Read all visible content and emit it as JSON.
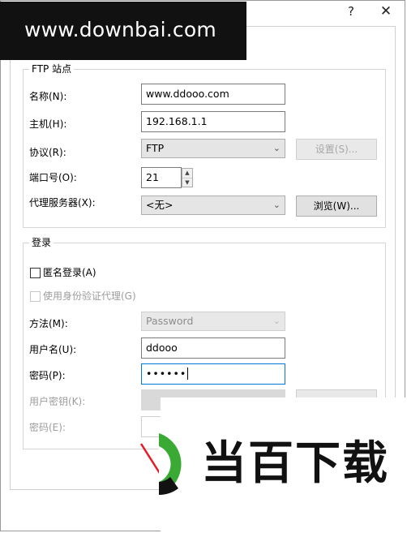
{
  "titlebar": {
    "help_label": "?",
    "close_label": "✕"
  },
  "watermark_top": {
    "text": "www.downbai.com"
  },
  "ftp_site": {
    "group_title": "FTP 站点",
    "name_label": "名称(N):",
    "name_value": "www.ddooo.com",
    "host_label": "主机(H):",
    "host_value": "192.168.1.1",
    "protocol_label": "协议(R):",
    "protocol_value": "FTP",
    "settings_button": "设置(S)...",
    "port_label": "端口号(O):",
    "port_value": "21",
    "proxy_label": "代理服务器(X):",
    "proxy_value": "<无>",
    "browse_button": "浏览(W)..."
  },
  "login": {
    "group_title": "登录",
    "anonymous_label": "匿名登录(A)",
    "auth_agent_label": "使用身份验证代理(G)",
    "method_label": "方法(M):",
    "method_value": "Password",
    "username_label": "用户名(U):",
    "username_value": "ddooo",
    "password_label": "密码(P):",
    "password_value": "••••••",
    "user_key_label": "用户密钥(K):",
    "key_password_label": "密码(E):"
  },
  "logo_watermark": {
    "text": "当百下载"
  },
  "icons": {
    "dropdown": "chevron-down-icon",
    "spin_up": "arrow-up-icon",
    "spin_down": "arrow-down-icon"
  },
  "colors": {
    "focus_border": "#0078d7",
    "logo_green": "#3aaa35",
    "logo_red": "#e31b23"
  }
}
